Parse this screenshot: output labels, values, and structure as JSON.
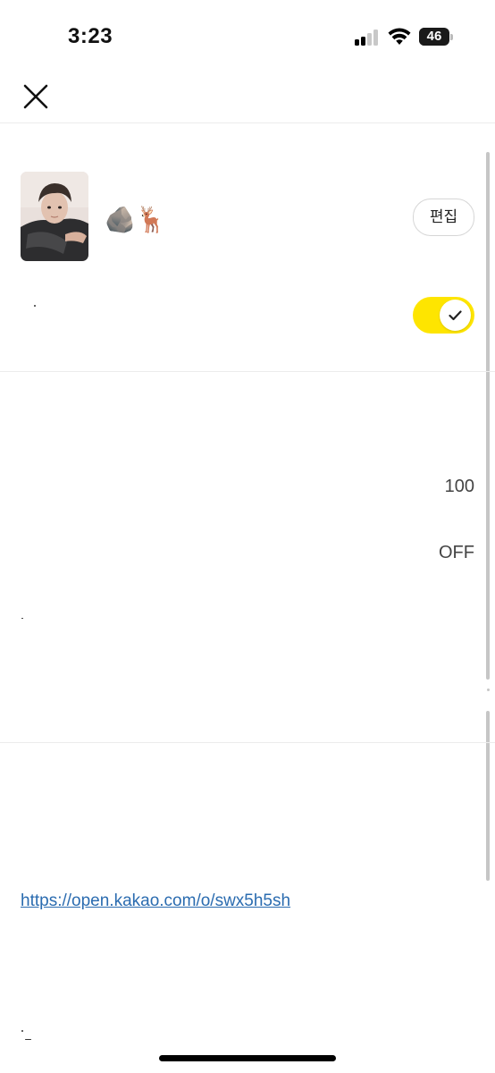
{
  "status_bar": {
    "time": "3:23",
    "battery": "46",
    "battery_level": 0.46,
    "signal_bars": 2
  },
  "header": {
    "close_icon": "close-icon"
  },
  "profile": {
    "emojis": "🪨🦌",
    "edit_label": "편집"
  },
  "toggle": {
    "on": true,
    "accent": "#FEE500",
    "icon": "checkmark-icon"
  },
  "settings": {
    "value_1": "100",
    "value_2": "OFF"
  },
  "link": {
    "url": "https://open.kakao.com/o/swx5h5sh"
  },
  "colors": {
    "link": "#2B6CB0",
    "divider": "#ECECEC"
  }
}
